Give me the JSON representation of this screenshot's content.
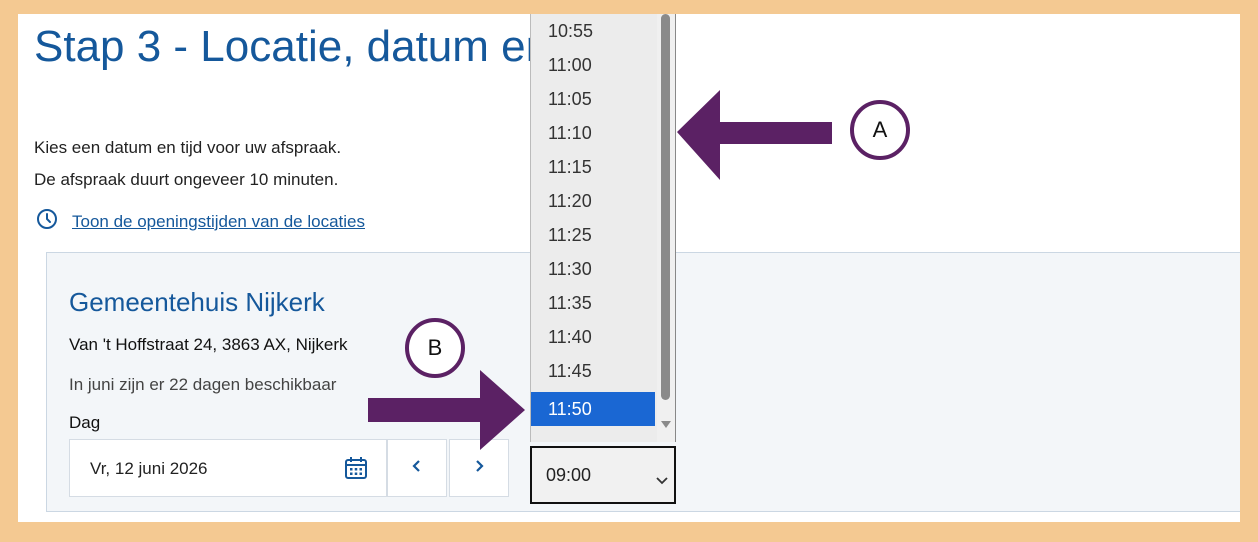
{
  "page": {
    "title": "Stap 3 - Locatie, datum en tijd",
    "intro_line1": "Kies een datum en tijd voor uw afspraak.",
    "intro_line2": "De afspraak duurt ongeveer 10 minuten.",
    "hours_link": "Toon de openingstijden van de locaties"
  },
  "location": {
    "name": "Gemeentehuis Nijkerk",
    "address": "Van 't Hoffstraat 24, 3863 AX, Nijkerk",
    "availability": "In juni zijn er 22 dagen beschikbaar",
    "day_label": "Dag",
    "date_value": "Vr, 12 juni 2026"
  },
  "time_select": {
    "value": "09:00",
    "options": [
      "10:55",
      "11:00",
      "11:05",
      "11:10",
      "11:15",
      "11:20",
      "11:25",
      "11:30",
      "11:35",
      "11:40",
      "11:45",
      "11:50"
    ],
    "selected_option": "11:50",
    "highlight_color": "#1a67d3"
  },
  "annotations": {
    "a_label": "A",
    "b_label": "B",
    "arrow_color": "#5b2164"
  },
  "colors": {
    "background_frame": "#f4c992",
    "link_blue": "#15589b"
  },
  "icons": {
    "clock": "clock-icon",
    "calendar": "calendar-icon",
    "prev": "chevron-left-icon",
    "next": "chevron-right-icon",
    "dropdown": "chevron-down-icon"
  }
}
